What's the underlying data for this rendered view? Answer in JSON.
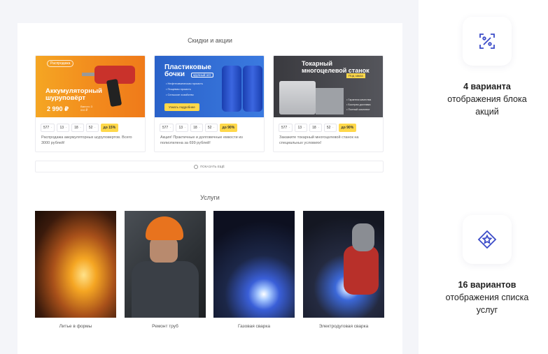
{
  "colors": {
    "accent": "#3b4bc8",
    "hot_badge": "#ffd84a",
    "panel_bg": "#f4f5f9"
  },
  "promotions": {
    "title": "Скидки и акции",
    "items": [
      {
        "banner_badge": "Распродажа",
        "banner_title": "Аккумуляторный шуруповёрт",
        "banner_price": "2 990 ₽",
        "banner_note": "Вместо 3 000 ₽",
        "stats": [
          "577",
          "13",
          "18",
          "52"
        ],
        "discount": "до 15%",
        "description": "Распродажа аккумуляторных шуруповертов. Всего 3000 рублей!"
      },
      {
        "banner_title": "Пластиковые бочки",
        "banner_tag": "крупный опт",
        "banner_list": [
          "• Нефтехимическая промсть",
          "• Пищевая промсть",
          "• Сельское хозяйство"
        ],
        "banner_button": "Узнать подробнее",
        "stats": [
          "577",
          "13",
          "18",
          "52"
        ],
        "discount": "до 90%",
        "description": "Акция! Практичные и долговечные емкости из полиэтилена за 699 рублей!"
      },
      {
        "banner_title": "Токарный многоцелевой станок",
        "banner_tag": "Под заказ",
        "banner_list": [
          "• Гарантия качества",
          "• Быстрая доставка",
          "• Полный комплект"
        ],
        "stats": [
          "577",
          "13",
          "18",
          "52"
        ],
        "discount": "до 90%",
        "description": "Закажите токарный многоцелевой станок на специальных условиях!"
      }
    ],
    "show_more": "ПОКАЗАТЬ ЕЩЁ"
  },
  "services": {
    "title": "Услуги",
    "items": [
      {
        "caption": "Литье в формы"
      },
      {
        "caption": "Ремонт труб"
      },
      {
        "caption": "Газовая сварка"
      },
      {
        "caption": "Электродуговая сварка"
      }
    ]
  },
  "features": [
    {
      "icon": "percent-badge-icon",
      "bold": "4 варианта",
      "text": "отображения блока акций"
    },
    {
      "icon": "star-diamond-icon",
      "bold": "16 вариантов",
      "text": "отображения списка услуг"
    }
  ]
}
